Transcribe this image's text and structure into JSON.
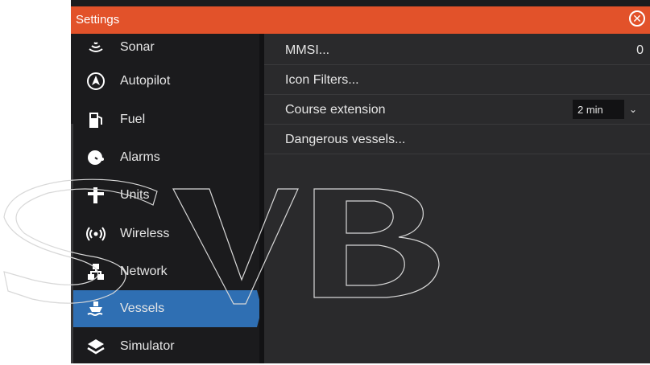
{
  "window": {
    "title": "Settings"
  },
  "sidebar": {
    "items": [
      {
        "label": "Sonar",
        "icon": "sonar-icon"
      },
      {
        "label": "Autopilot",
        "icon": "autopilot-icon"
      },
      {
        "label": "Fuel",
        "icon": "fuel-pump-icon"
      },
      {
        "label": "Alarms",
        "icon": "alarm-bell-icon"
      },
      {
        "label": "Units",
        "icon": "ruler-icon"
      },
      {
        "label": "Wireless",
        "icon": "wireless-icon"
      },
      {
        "label": "Network",
        "icon": "network-icon"
      },
      {
        "label": "Vessels",
        "icon": "vessel-icon",
        "active": true
      },
      {
        "label": "Simulator",
        "icon": "layers-icon"
      }
    ]
  },
  "content": {
    "rows": [
      {
        "label": "MMSI...",
        "value": "0"
      },
      {
        "label": "Icon Filters..."
      },
      {
        "label": "Course extension",
        "select_value": "2 min"
      },
      {
        "label": "Dangerous vessels..."
      }
    ]
  },
  "colors": {
    "title_bar": "#e2522a",
    "active_item": "#2f6fb3",
    "panel_bg": "#2a2a2c",
    "sidebar_bg": "#1b1b1d"
  }
}
